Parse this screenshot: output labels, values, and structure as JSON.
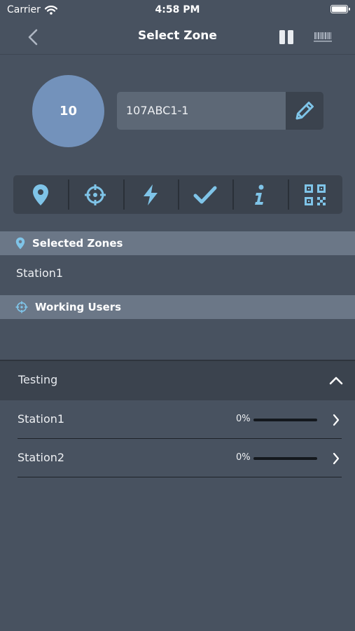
{
  "status_bar": {
    "carrier": "Carrier",
    "time": "4:58 PM"
  },
  "navbar": {
    "title": "Select Zone"
  },
  "zone": {
    "number": "10",
    "device_id": "107ABC1-1"
  },
  "toolbar": {
    "icons": [
      "location-pin-icon",
      "crosshair-icon",
      "lightning-icon",
      "checkmark-icon",
      "info-icon",
      "qr-code-icon"
    ]
  },
  "sections": {
    "selected_zones": {
      "title": "Selected Zones",
      "items": [
        "Station1"
      ]
    },
    "working_users": {
      "title": "Working Users",
      "items": []
    }
  },
  "group": {
    "title": "Testing",
    "stations": [
      {
        "name": "Station1",
        "progress_label": "0%",
        "progress": 0
      },
      {
        "name": "Station2",
        "progress_label": "0%",
        "progress": 0
      }
    ]
  },
  "colors": {
    "background": "#485260",
    "accent": "#7fc4e8",
    "zone_circle": "#7392bb",
    "section_header": "#6b7787",
    "dark_panel": "#3b434e"
  }
}
